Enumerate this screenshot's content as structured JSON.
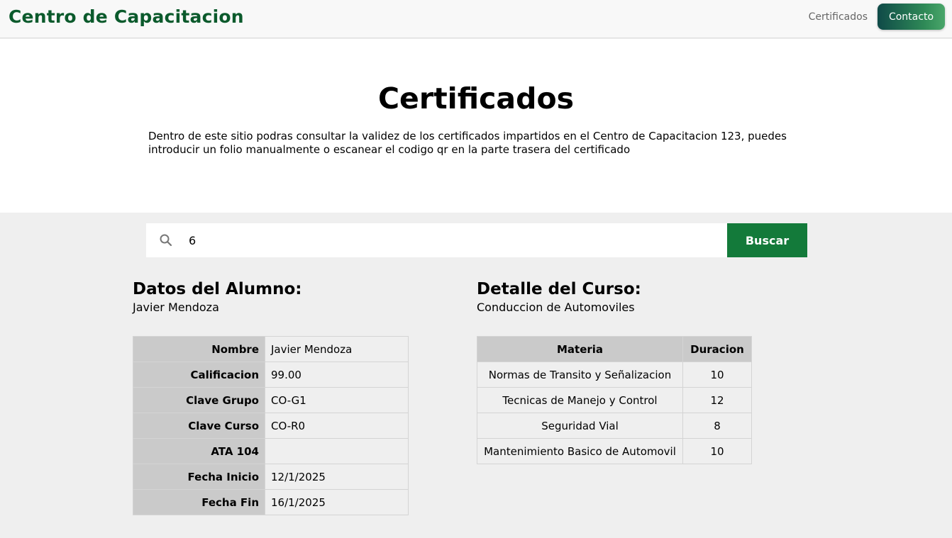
{
  "navbar": {
    "brand": "Centro de Capacitacion",
    "link_certificados": "Certificados",
    "button_contacto": "Contacto"
  },
  "hero": {
    "title": "Certificados",
    "description": "Dentro de este sitio podras consultar la validez de los certificados impartidos en el Centro de Capacitacion 123, puedes introducir un folio manualmente o escanear el codigo qr en la parte trasera del certificado"
  },
  "search": {
    "icon": "search-icon",
    "value": "6",
    "button_label": "Buscar"
  },
  "student": {
    "heading": "Datos del Alumno:",
    "name": "Javier Mendoza",
    "rows": [
      {
        "label": "Nombre",
        "value": "Javier Mendoza"
      },
      {
        "label": "Calificacion",
        "value": "99.00"
      },
      {
        "label": "Clave Grupo",
        "value": "CO-G1"
      },
      {
        "label": "Clave Curso",
        "value": "CO-R0"
      },
      {
        "label": "ATA 104",
        "value": ""
      },
      {
        "label": "Fecha Inicio",
        "value": "12/1/2025"
      },
      {
        "label": "Fecha Fin",
        "value": "16/1/2025"
      }
    ]
  },
  "course": {
    "heading": "Detalle del Curso:",
    "name": "Conduccion de Automoviles",
    "columns": [
      "Materia",
      "Duracion"
    ],
    "rows": [
      {
        "materia": "Normas de Transito y Señalizacion",
        "duracion": "10"
      },
      {
        "materia": "Tecnicas de Manejo y Control",
        "duracion": "12"
      },
      {
        "materia": "Seguridad Vial",
        "duracion": "8"
      },
      {
        "materia": "Mantenimiento Basico de Automovil",
        "duracion": "10"
      }
    ]
  },
  "colors": {
    "brand_green": "#0b5a2c",
    "button_green": "#137a3a",
    "table_header_gray": "#cacaca",
    "page_gray": "#efefef"
  }
}
